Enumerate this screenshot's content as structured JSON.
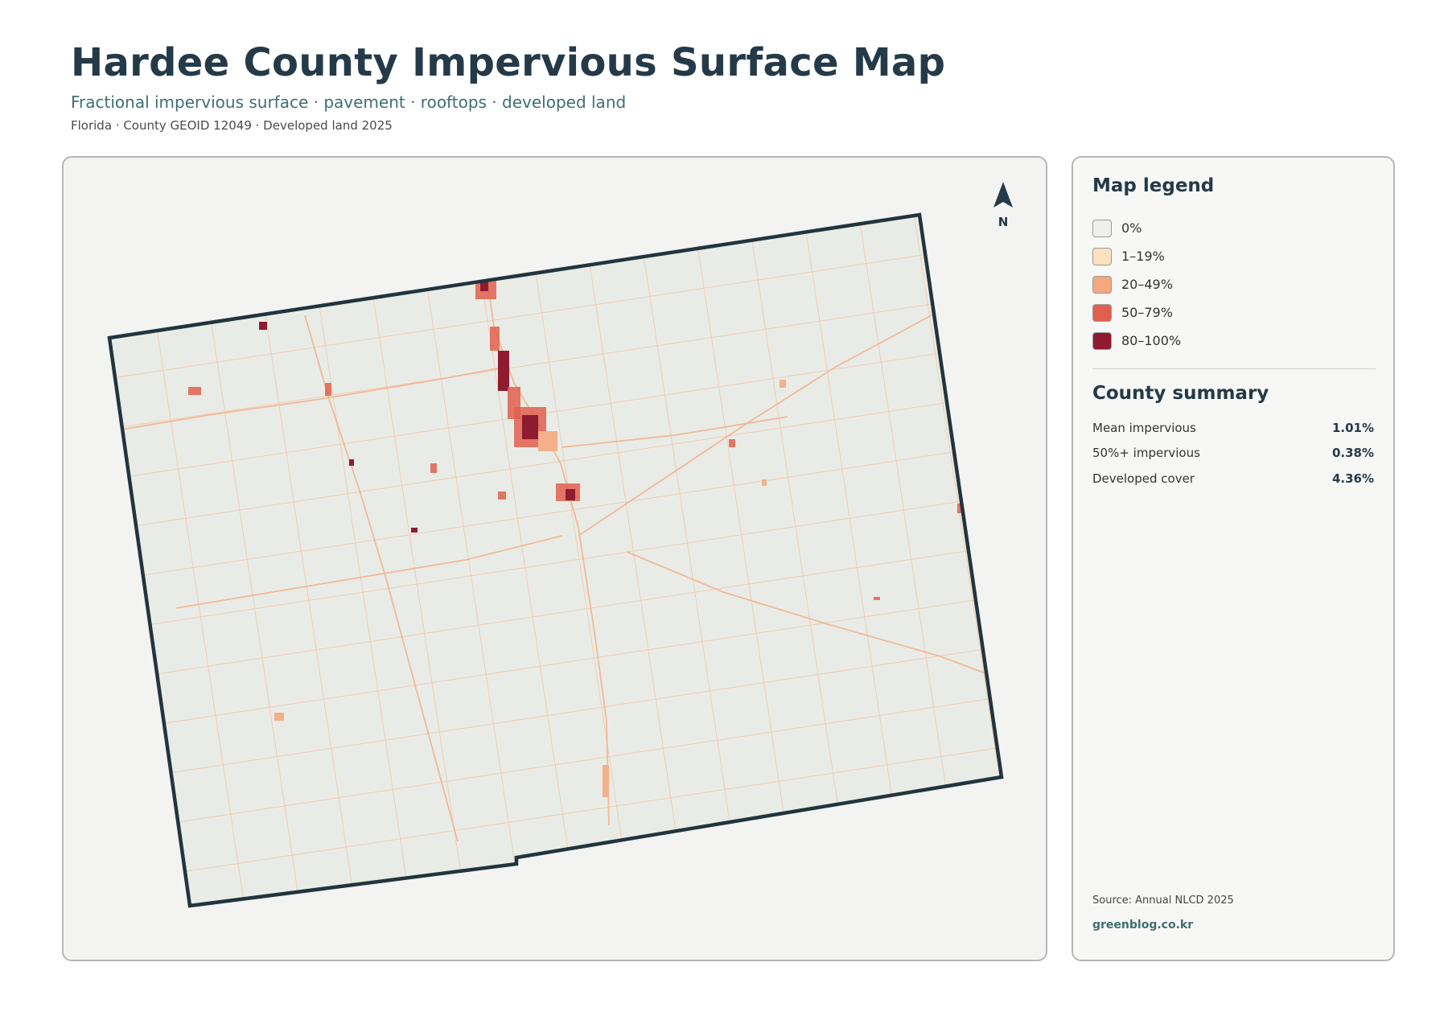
{
  "header": {
    "title": "Hardee County Impervious Surface Map",
    "subtitle": "Fractional impervious surface · pavement · rooftops · developed land",
    "meta": "Florida · County GEOID 12049 · Developed land 2025"
  },
  "map": {
    "north_label": "N",
    "colors": {
      "county_fill": "#e9ece6",
      "county_outline": "#22343d",
      "roads_low": "#f4b089",
      "urban_mid": "#e0604e",
      "urban_high": "#8e1b30"
    }
  },
  "legend": {
    "title": "Map legend",
    "items": [
      {
        "label": "0%",
        "color": "#efefed"
      },
      {
        "label": "1–19%",
        "color": "#fde0bd"
      },
      {
        "label": "20–49%",
        "color": "#f5a77e"
      },
      {
        "label": "50–79%",
        "color": "#e05f4e"
      },
      {
        "label": "80–100%",
        "color": "#8e1b30"
      }
    ]
  },
  "summary": {
    "title": "County summary",
    "rows": [
      {
        "label": "Mean impervious",
        "value": "1.01%"
      },
      {
        "label": "50%+ impervious",
        "value": "0.38%"
      },
      {
        "label": "Developed cover",
        "value": "4.36%"
      }
    ]
  },
  "footer": {
    "source": "Source: Annual NLCD 2025",
    "website": "greenblog.co.kr"
  }
}
